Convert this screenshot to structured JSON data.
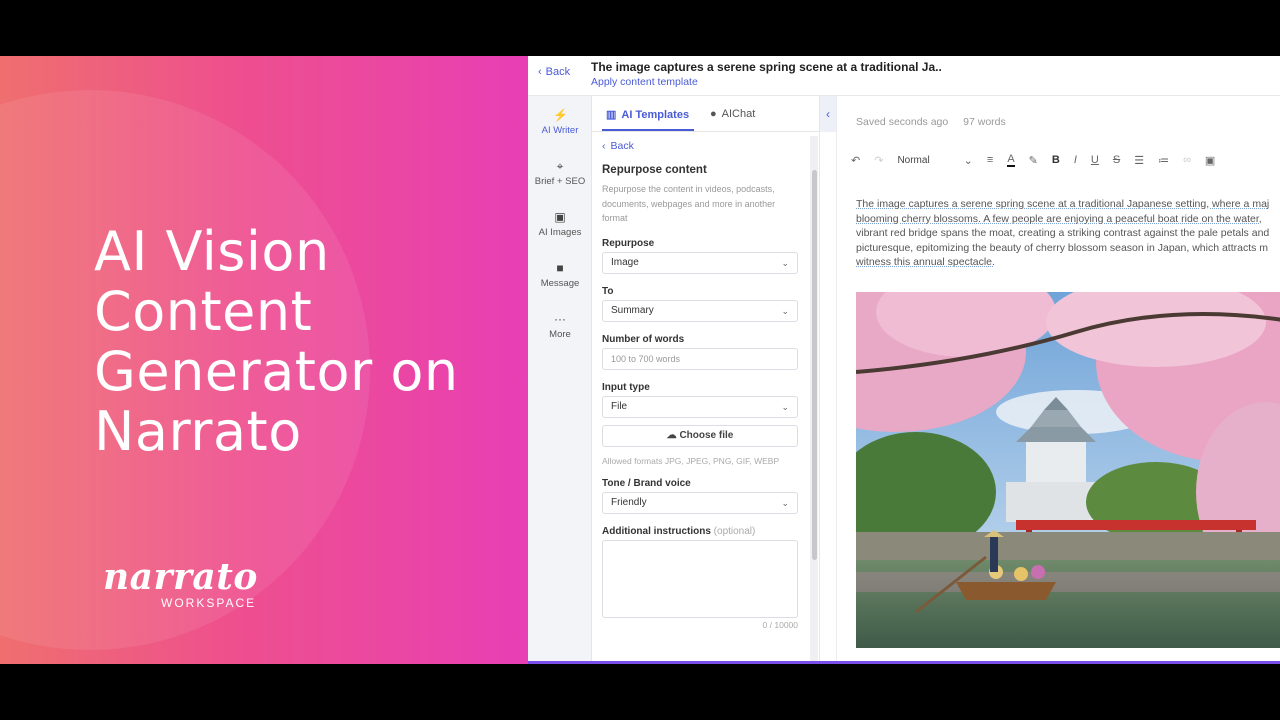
{
  "promo": {
    "headline_lines": [
      "AI Vision",
      "Content",
      "Generator on",
      "Narrato"
    ],
    "logo_word": "narrato",
    "logo_sub": "WORKSPACE"
  },
  "topbar": {
    "back": "Back",
    "doc_title": "The image captures a serene spring scene at a traditional Ja..",
    "template_link": "Apply content template"
  },
  "sidenav": [
    {
      "label": "AI Writer",
      "icon": "lightning-icon"
    },
    {
      "label": "Brief + SEO",
      "icon": "target-icon"
    },
    {
      "label": "AI Images",
      "icon": "image-icon"
    },
    {
      "label": "Message",
      "icon": "message-icon"
    },
    {
      "label": "More",
      "icon": "more-icon"
    }
  ],
  "tabs": {
    "templates": "AI Templates",
    "chat": "AIChat"
  },
  "form": {
    "back": "Back",
    "title": "Repurpose content",
    "description": "Repurpose the content in videos, podcasts, documents, webpages and more in another format",
    "repurpose_label": "Repurpose",
    "repurpose_value": "Image",
    "to_label": "To",
    "to_value": "Summary",
    "words_label": "Number of words",
    "words_placeholder": "100 to 700 words",
    "input_type_label": "Input type",
    "input_type_value": "File",
    "choose_file": "Choose file",
    "allowed_formats": "Allowed formats JPG, JPEG, PNG, GIF, WEBP",
    "tone_label": "Tone / Brand voice",
    "tone_value": "Friendly",
    "instructions_label": "Additional instructions",
    "instructions_optional": "(optional)",
    "counter": "0 / 10000"
  },
  "editor": {
    "saved": "Saved seconds ago",
    "words": "97 words",
    "style": "Normal",
    "lines": [
      "The image captures a serene spring scene at a traditional Japanese setting, where a maj",
      "blooming cherry blossoms. A few people are enjoying a peaceful boat ride on the water,",
      "vibrant red bridge spans the moat, creating a striking contrast against the pale petals and",
      "picturesque, epitomizing the beauty of cherry blossom season in Japan, which attracts m",
      "witness this annual spectacle."
    ]
  },
  "colors": {
    "accent": "#4a5bd6",
    "gradient_start": "#ef6f6f",
    "gradient_end": "#e83fb5"
  }
}
